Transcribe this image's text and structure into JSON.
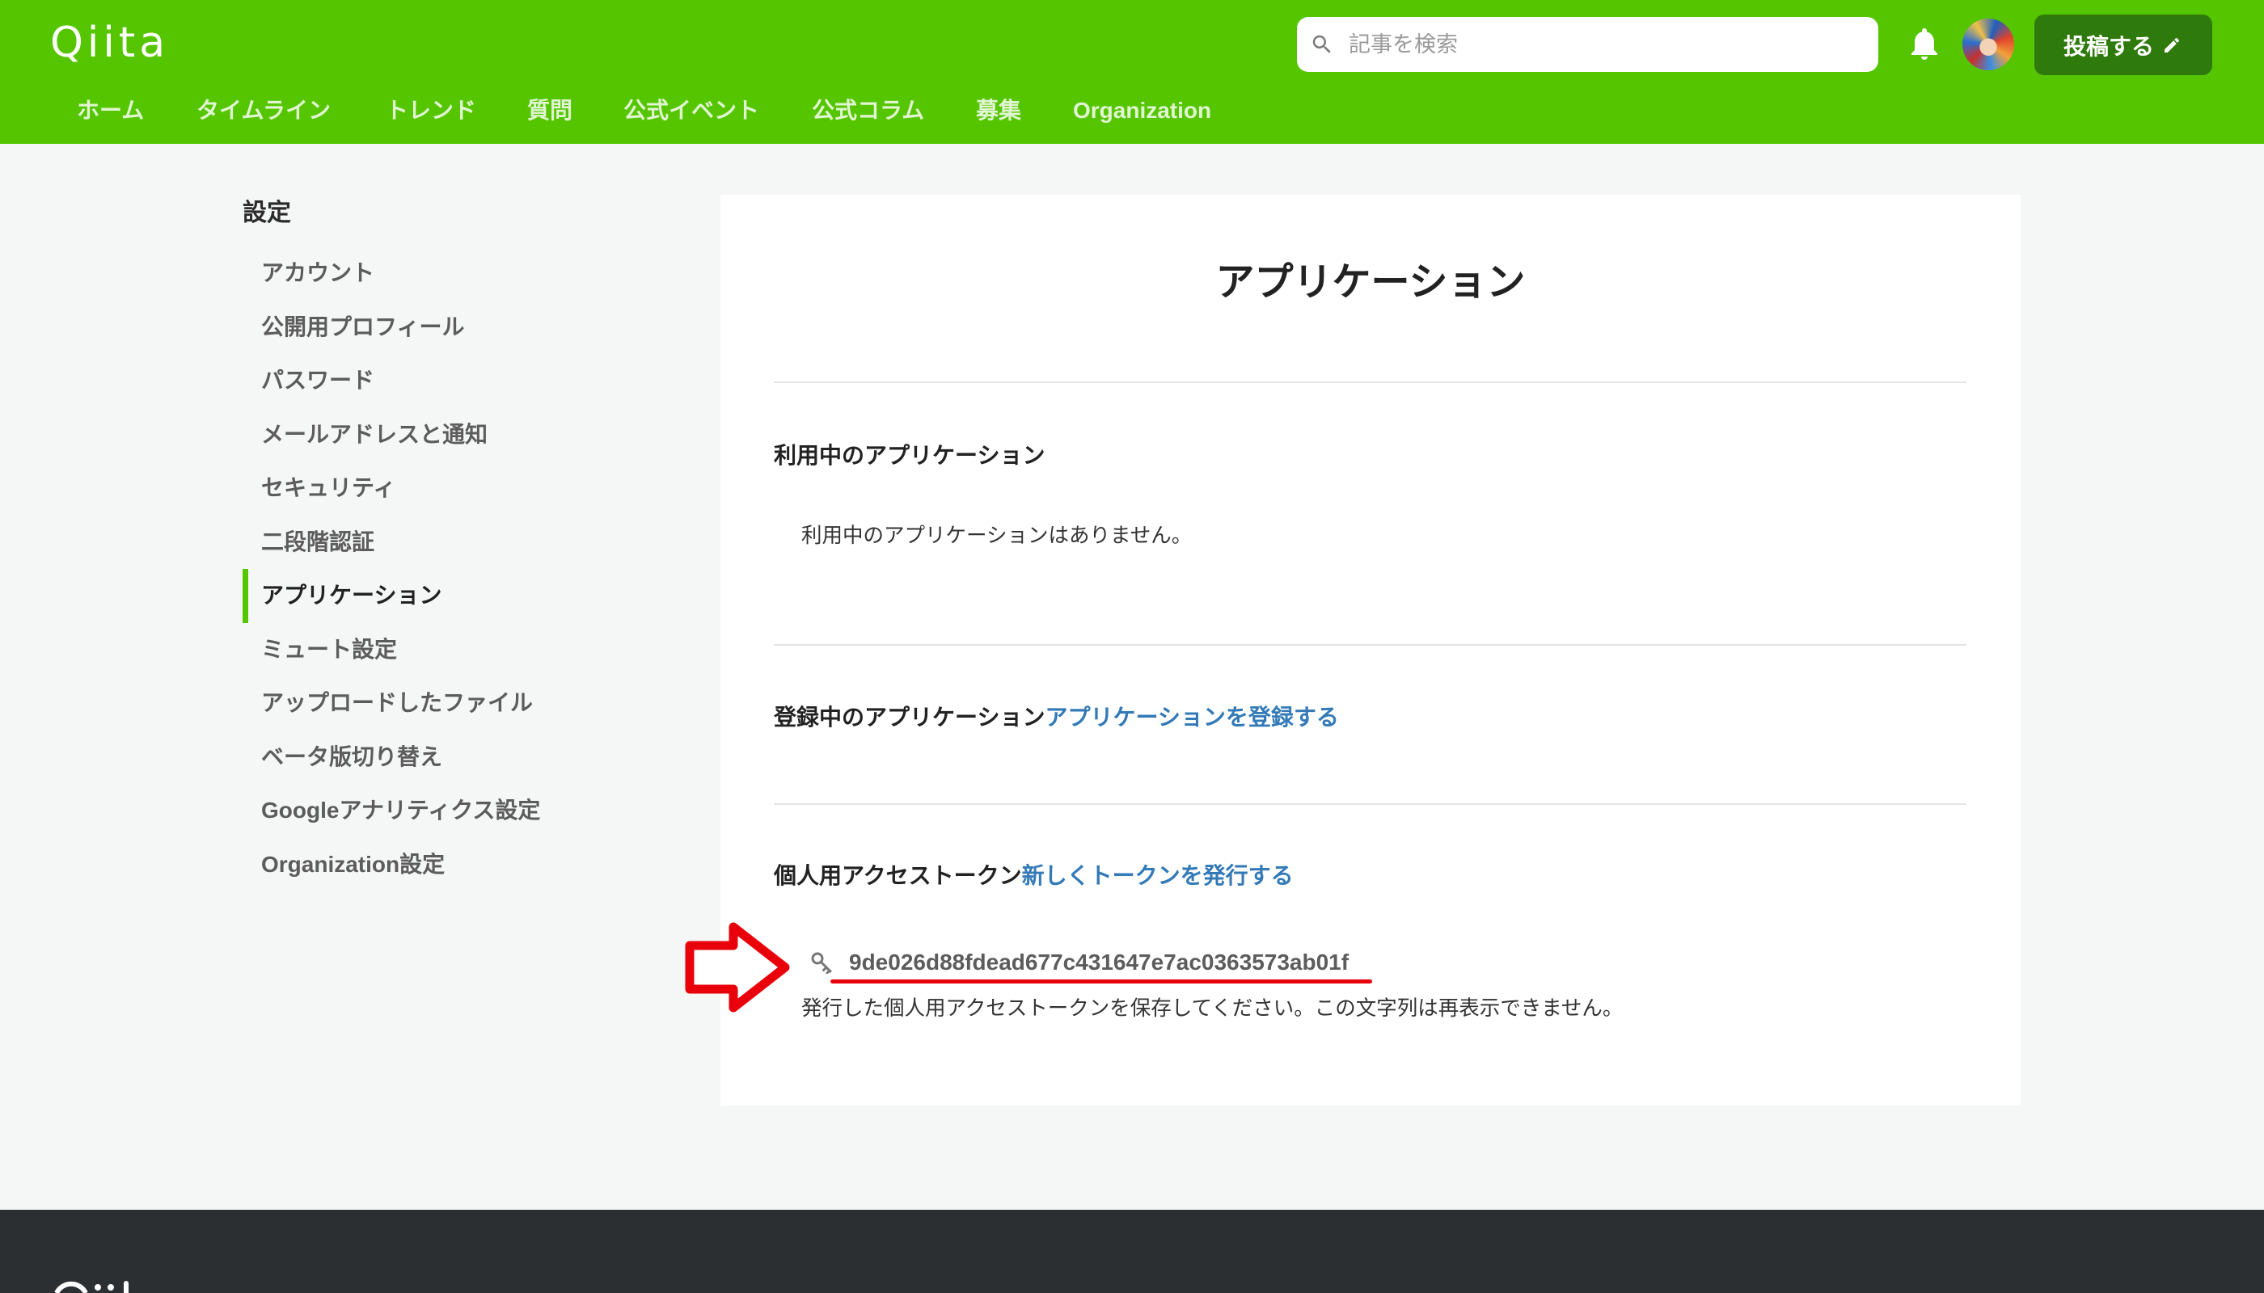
{
  "header": {
    "logo": "Qiita",
    "search": {
      "placeholder": "記事を検索"
    },
    "post_button": "投稿する",
    "nav": [
      "ホーム",
      "タイムライン",
      "トレンド",
      "質問",
      "公式イベント",
      "公式コラム",
      "募集",
      "Organization"
    ]
  },
  "sidebar": {
    "title": "設定",
    "items": [
      {
        "label": "アカウント",
        "active": false
      },
      {
        "label": "公開用プロフィール",
        "active": false
      },
      {
        "label": "パスワード",
        "active": false
      },
      {
        "label": "メールアドレスと通知",
        "active": false
      },
      {
        "label": "セキュリティ",
        "active": false
      },
      {
        "label": "二段階認証",
        "active": false
      },
      {
        "label": "アプリケーション",
        "active": true
      },
      {
        "label": "ミュート設定",
        "active": false
      },
      {
        "label": "アップロードしたファイル",
        "active": false
      },
      {
        "label": "ベータ版切り替え",
        "active": false
      },
      {
        "label": "Googleアナリティクス設定",
        "active": false
      },
      {
        "label": "Organization設定",
        "active": false
      }
    ]
  },
  "main": {
    "title": "アプリケーション",
    "in_use": {
      "heading": "利用中のアプリケーション",
      "empty_message": "利用中のアプリケーションはありません。"
    },
    "registered": {
      "heading": "登録中のアプリケーション",
      "register_link": "アプリケーションを登録する"
    },
    "personal_access_tokens": {
      "heading": "個人用アクセストークン",
      "new_token_link": "新しくトークンを発行する",
      "token": "9de026d88fdead677c431647e7ac0363573ab01f",
      "notice": "発行した個人用アクセストークンを保存してください。この文字列は再表示できません。"
    }
  },
  "icons": {
    "search": "search-icon",
    "notifications": "bell-icon",
    "post": "pencil-icon",
    "token": "key-icon",
    "annotation": "arrow-right-icon"
  },
  "colors": {
    "brand": "#55c500",
    "post_button": "#2f7a0c",
    "link": "#337ab7",
    "annotation": "#e8000b",
    "footer": "#2c2f32"
  }
}
